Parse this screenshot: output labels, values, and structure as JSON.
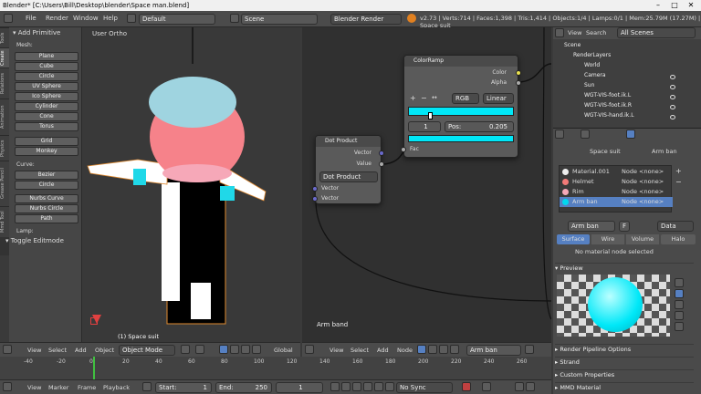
{
  "window": {
    "title": "Blender* [C:\\Users\\Bill\\Desktop\\blender\\Space man.blend]"
  },
  "infobar": {
    "menus": [
      "File",
      "Render",
      "Window",
      "Help"
    ],
    "layout": "Default",
    "scene": "Scene",
    "engine": "Blender Render",
    "stats": "v2.73 | Verts:714 | Faces:1,398 | Tris:1,414 | Objects:1/4 | Lamps:0/1 | Mem:25.79M (17.27M) | Space suit"
  },
  "toolshelf": {
    "tabs": [
      "Tools",
      "Create",
      "Relations",
      "Animation",
      "Physics",
      "Grease Pencil",
      "Mmd Tool"
    ],
    "add_primitive": "Add Primitive",
    "mesh_label": "Mesh:",
    "mesh": [
      "Plane",
      "Cube",
      "Circle",
      "UV Sphere",
      "Ico Sphere",
      "Cylinder",
      "Cone",
      "Torus"
    ],
    "grid": "Grid",
    "monkey": "Monkey",
    "curve_label": "Curve:",
    "curve1": [
      "Bezier",
      "Circle"
    ],
    "curve2": [
      "Nurbs Curve",
      "Nurbs Circle",
      "Path"
    ],
    "lamp_label": "Lamp:",
    "toggle_editmode": "Toggle Editmode"
  },
  "viewport": {
    "label": "User Ortho",
    "object_label": "(1) Space suit",
    "menus": [
      "View",
      "Select",
      "Add",
      "Object"
    ],
    "mode": "Object Mode",
    "orientation": "Global"
  },
  "nodes": {
    "colorramp": {
      "title": "ColorRamp",
      "outputs": [
        "Color",
        "Alpha"
      ],
      "interp1": "RGB",
      "interp2": "Linear",
      "index": "1",
      "pos_label": "Pos:",
      "pos_value": "0.205",
      "input": "Fac"
    },
    "dot": {
      "title": "Dot Product",
      "outputs": [
        "Vector",
        "Value"
      ],
      "mode": "Dot Product",
      "inputs": [
        "Vector",
        "Vector"
      ]
    },
    "label": "Arm band",
    "menus": [
      "View",
      "Select",
      "Add",
      "Node"
    ],
    "material": "Arm ban"
  },
  "outliner": {
    "view": "View",
    "search": "Search",
    "filter": "All Scenes",
    "items": [
      "Scene",
      "RenderLayers",
      "World",
      "Camera",
      "Sun",
      "WGT-VIS-foot.ik.L",
      "WGT-VIS-foot.ik.R",
      "WGT-VIS-hand.ik.L"
    ]
  },
  "properties": {
    "breadcrumb_obj": "Space suit",
    "breadcrumb_mat": "Arm ban",
    "materials": [
      {
        "name": "Material.001",
        "node": "Node <none>",
        "color": "#eeeeee"
      },
      {
        "name": "Helmet",
        "node": "Node <none>",
        "color": "#f27a78"
      },
      {
        "name": "Rim",
        "node": "Node <none>",
        "color": "#f6a8b8"
      },
      {
        "name": "Arm ban",
        "node": "Node <none>",
        "color": "#00d8f0"
      }
    ],
    "mat_field": "Arm ban",
    "f_label": "F",
    "data_label": "Data",
    "tabs": [
      "Surface",
      "Wire",
      "Volume",
      "Halo"
    ],
    "no_node": "No material node selected",
    "preview": "Preview",
    "panels": [
      "Render Pipeline Options",
      "Strand",
      "Custom Properties",
      "MMD Material"
    ]
  },
  "timeline": {
    "ticks": [
      "-40",
      "-20",
      "0",
      "20",
      "40",
      "60",
      "80",
      "100",
      "120",
      "140",
      "160",
      "180",
      "200",
      "220",
      "240",
      "260"
    ],
    "menus": [
      "View",
      "Marker",
      "Frame",
      "Playback"
    ],
    "start_label": "Start:",
    "start": "1",
    "end_label": "End:",
    "end": "250",
    "current": "1",
    "sync": "No Sync"
  },
  "colors": {
    "accent": "#00e8f8",
    "selected": "#5680c2",
    "helmet": "#f47a76"
  }
}
